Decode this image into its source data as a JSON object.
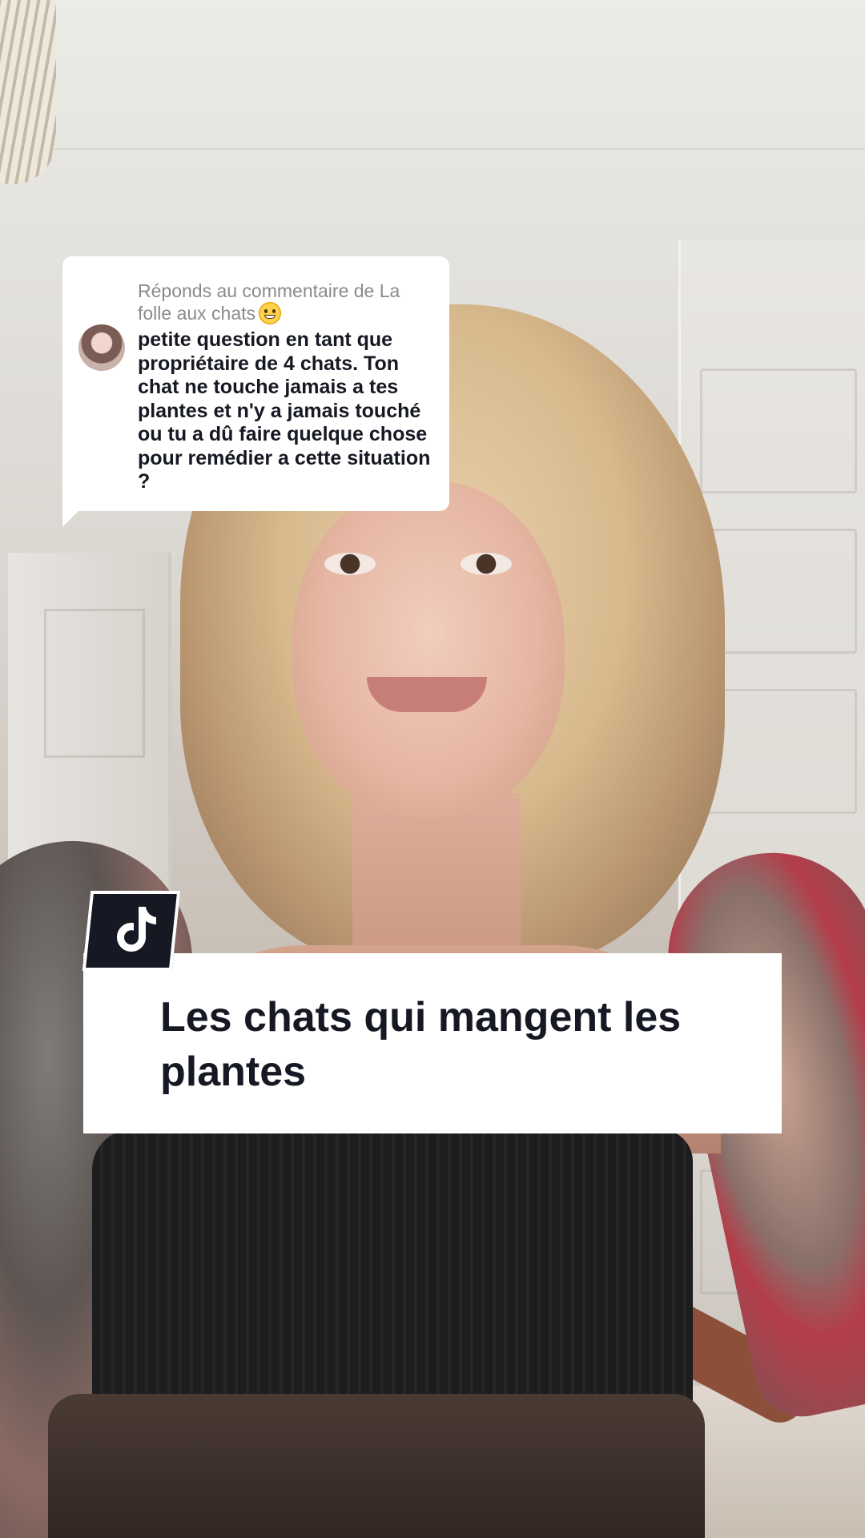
{
  "reply": {
    "header": "Réponds au commentaire de La folle aux chats",
    "body": "petite question en tant que propriétaire de 4 chats. Ton chat ne touche jamais a tes plantes et n'y a jamais touché ou tu a dû faire quelque chose pour remédier a cette situation ?",
    "emoji_icon": "grinning-face-icon"
  },
  "title_card": {
    "text": "Les chats qui mangent les plantes",
    "logo_icon": "tiktok-logo-icon"
  },
  "colors": {
    "card_background": "#ffffff",
    "title_text": "#161823",
    "reply_header_text": "#8a8a8f",
    "badge_background": "#161823"
  }
}
